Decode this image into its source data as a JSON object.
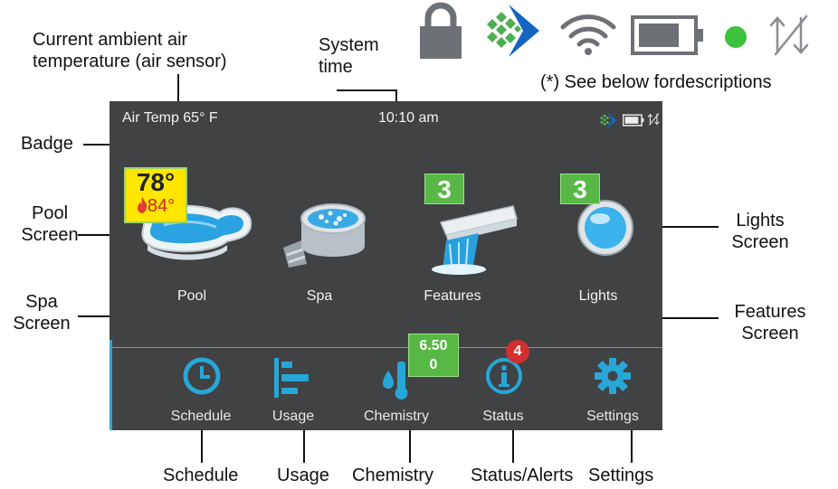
{
  "callouts": {
    "air_temp": [
      "Current ambient air",
      "temperature (air sensor)"
    ],
    "system_time": [
      "System",
      "time"
    ],
    "see_below": "(*) See below fordescriptions",
    "badge": "Badge",
    "pool_screen": [
      "Pool",
      "Screen"
    ],
    "spa_screen": [
      "Spa",
      "Screen"
    ],
    "lights_screen": [
      "Lights",
      "Screen"
    ],
    "features_screen": [
      "Features",
      "Screen"
    ],
    "bottom": [
      "Schedule",
      "Usage",
      "Chemistry",
      "Status/Alerts",
      "Settings"
    ]
  },
  "top_status_icons": [
    "lock-icon",
    "brand-logo-icon",
    "wifi-icon",
    "battery-icon",
    "status-dot-icon",
    "data-transfer-icon"
  ],
  "screen": {
    "air_temp": "Air Temp 65° F",
    "time": "10:10 am",
    "status_icons": [
      "brand-logo-icon",
      "battery-icon",
      "data-transfer-icon"
    ],
    "tiles": [
      {
        "label": "Pool",
        "temp": "78°",
        "set_temp": "84°"
      },
      {
        "label": "Spa"
      },
      {
        "label": "Features",
        "badge": "3"
      },
      {
        "label": "Lights",
        "badge": "3"
      }
    ],
    "nav": [
      {
        "label": "Schedule",
        "icon": "clock-icon"
      },
      {
        "label": "Usage",
        "icon": "usage-bars-icon"
      },
      {
        "label": "Chemistry",
        "icon": "chemistry-icon",
        "badge_line1": "6.50",
        "badge_line2": "0"
      },
      {
        "label": "Status",
        "icon": "info-icon",
        "alert_count": "4"
      },
      {
        "label": "Settings",
        "icon": "gear-icon"
      }
    ]
  },
  "colors": {
    "screen_bg": "#414244",
    "accent_teal": "#27a6d8",
    "badge_green": "#57b845",
    "temp_yellow": "#ffe600",
    "alert_red": "#d32f2f",
    "icon_gray": "#6d7074",
    "brand_blue": "#1565c0",
    "brand_green": "#4caf50"
  }
}
